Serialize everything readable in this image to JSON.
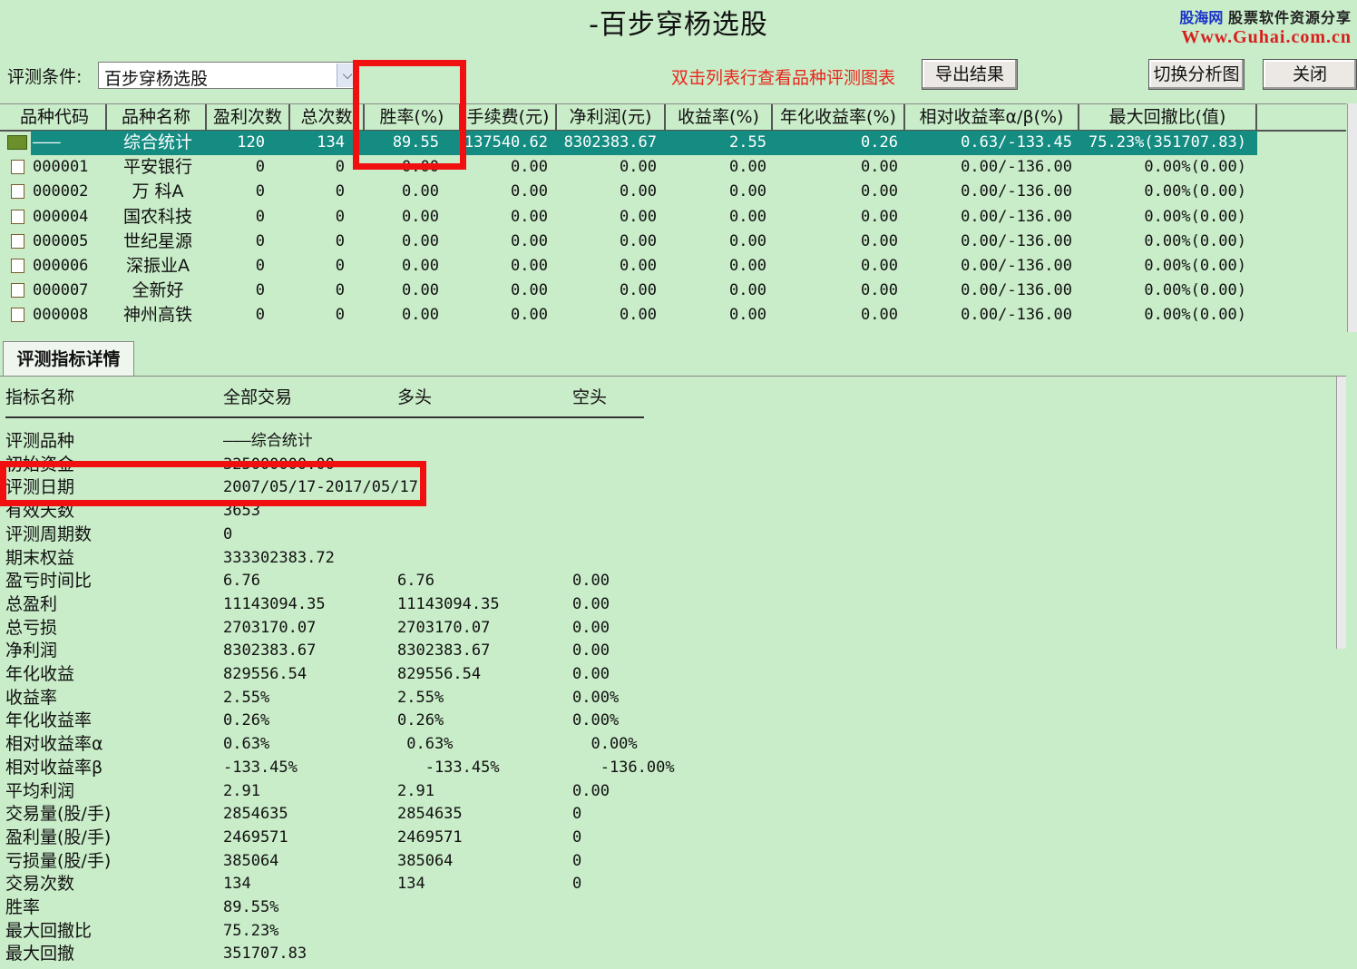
{
  "window": {
    "title": "-百步穿杨选股"
  },
  "watermark": {
    "brand": "股海网",
    "tagline": "股票软件资源分享",
    "url": "Www.Guhai.com.cn"
  },
  "toolbar": {
    "condition_label": "评测条件:",
    "condition_value": "百步穿杨选股",
    "hint": "双击列表行查看品种评测图表",
    "export_label": "导出结果",
    "switch_label": "切换分析图",
    "close_label": "关闭"
  },
  "table": {
    "columns": [
      "品种代码",
      "品种名称",
      "盈利次数",
      "总次数",
      "胜率(%)",
      "手续费(元)",
      "净利润(元)",
      "收益率(%)",
      "年化收益率(%)",
      "相对收益率α/β(%)",
      "最大回撤比(值)"
    ],
    "rows": [
      [
        "———",
        "综合统计",
        "120",
        "134",
        "89.55",
        "137540.62",
        "8302383.67",
        "2.55",
        "0.26",
        "0.63/-133.45",
        "75.23%(351707.83)"
      ],
      [
        "000001",
        "平安银行",
        "0",
        "0",
        "0.00",
        "0.00",
        "0.00",
        "0.00",
        "0.00",
        "0.00/-136.00",
        "0.00%(0.00)"
      ],
      [
        "000002",
        "万 科A",
        "0",
        "0",
        "0.00",
        "0.00",
        "0.00",
        "0.00",
        "0.00",
        "0.00/-136.00",
        "0.00%(0.00)"
      ],
      [
        "000004",
        "国农科技",
        "0",
        "0",
        "0.00",
        "0.00",
        "0.00",
        "0.00",
        "0.00",
        "0.00/-136.00",
        "0.00%(0.00)"
      ],
      [
        "000005",
        "世纪星源",
        "0",
        "0",
        "0.00",
        "0.00",
        "0.00",
        "0.00",
        "0.00",
        "0.00/-136.00",
        "0.00%(0.00)"
      ],
      [
        "000006",
        "深振业A",
        "0",
        "0",
        "0.00",
        "0.00",
        "0.00",
        "0.00",
        "0.00",
        "0.00/-136.00",
        "0.00%(0.00)"
      ],
      [
        "000007",
        "全新好",
        "0",
        "0",
        "0.00",
        "0.00",
        "0.00",
        "0.00",
        "0.00",
        "0.00/-136.00",
        "0.00%(0.00)"
      ],
      [
        "000008",
        "神州高铁",
        "0",
        "0",
        "0.00",
        "0.00",
        "0.00",
        "0.00",
        "0.00",
        "0.00/-136.00",
        "0.00%(0.00)"
      ]
    ]
  },
  "detail": {
    "tab_label": "评测指标详情",
    "headers": [
      "指标名称",
      "全部交易",
      "多头",
      "空头"
    ],
    "rows": [
      [
        "评测品种",
        "———综合统计",
        "",
        ""
      ],
      [
        "初始资金",
        "325000000.00",
        "",
        ""
      ],
      [
        "评测日期",
        "2007/05/17-2017/05/17",
        "",
        ""
      ],
      [
        "有效天数",
        "3653",
        "",
        ""
      ],
      [
        "评测周期数",
        "0",
        "",
        ""
      ],
      [
        "期末权益",
        "333302383.72",
        "",
        ""
      ],
      [
        "盈亏时间比",
        "6.76",
        "6.76",
        "0.00"
      ],
      [
        "总盈利",
        "11143094.35",
        "11143094.35",
        "0.00"
      ],
      [
        "总亏损",
        "2703170.07",
        "2703170.07",
        "0.00"
      ],
      [
        "净利润",
        "8302383.67",
        "8302383.67",
        "0.00"
      ],
      [
        "年化收益",
        "829556.54",
        "829556.54",
        "0.00"
      ],
      [
        "收益率",
        "2.55%",
        "2.55%",
        "0.00%"
      ],
      [
        "年化收益率",
        "0.26%",
        "0.26%",
        "0.00%"
      ],
      [
        "相对收益率α",
        "0.63%",
        " 0.63%",
        "  0.00%"
      ],
      [
        "相对收益率β",
        "-133.45%",
        "   -133.45%",
        "   -136.00%"
      ],
      [
        "平均利润",
        "2.91",
        "2.91",
        "0.00"
      ],
      [
        "交易量(股/手)",
        "2854635",
        "2854635",
        "0"
      ],
      [
        "盈利量(股/手)",
        "2469571",
        "2469571",
        "0"
      ],
      [
        "亏损量(股/手)",
        "385064",
        "385064",
        "0"
      ],
      [
        "交易次数",
        "134",
        "134",
        "0"
      ],
      [
        "胜率",
        "89.55%",
        "",
        ""
      ],
      [
        "最大回撤比",
        "75.23%",
        "",
        ""
      ],
      [
        "最大回撤",
        "351707.83",
        "",
        ""
      ]
    ]
  },
  "colors": {
    "background": "#c9ecc9",
    "selected_row": "#148c82",
    "hint": "#e8281c",
    "highlight_box": "#f01010"
  }
}
